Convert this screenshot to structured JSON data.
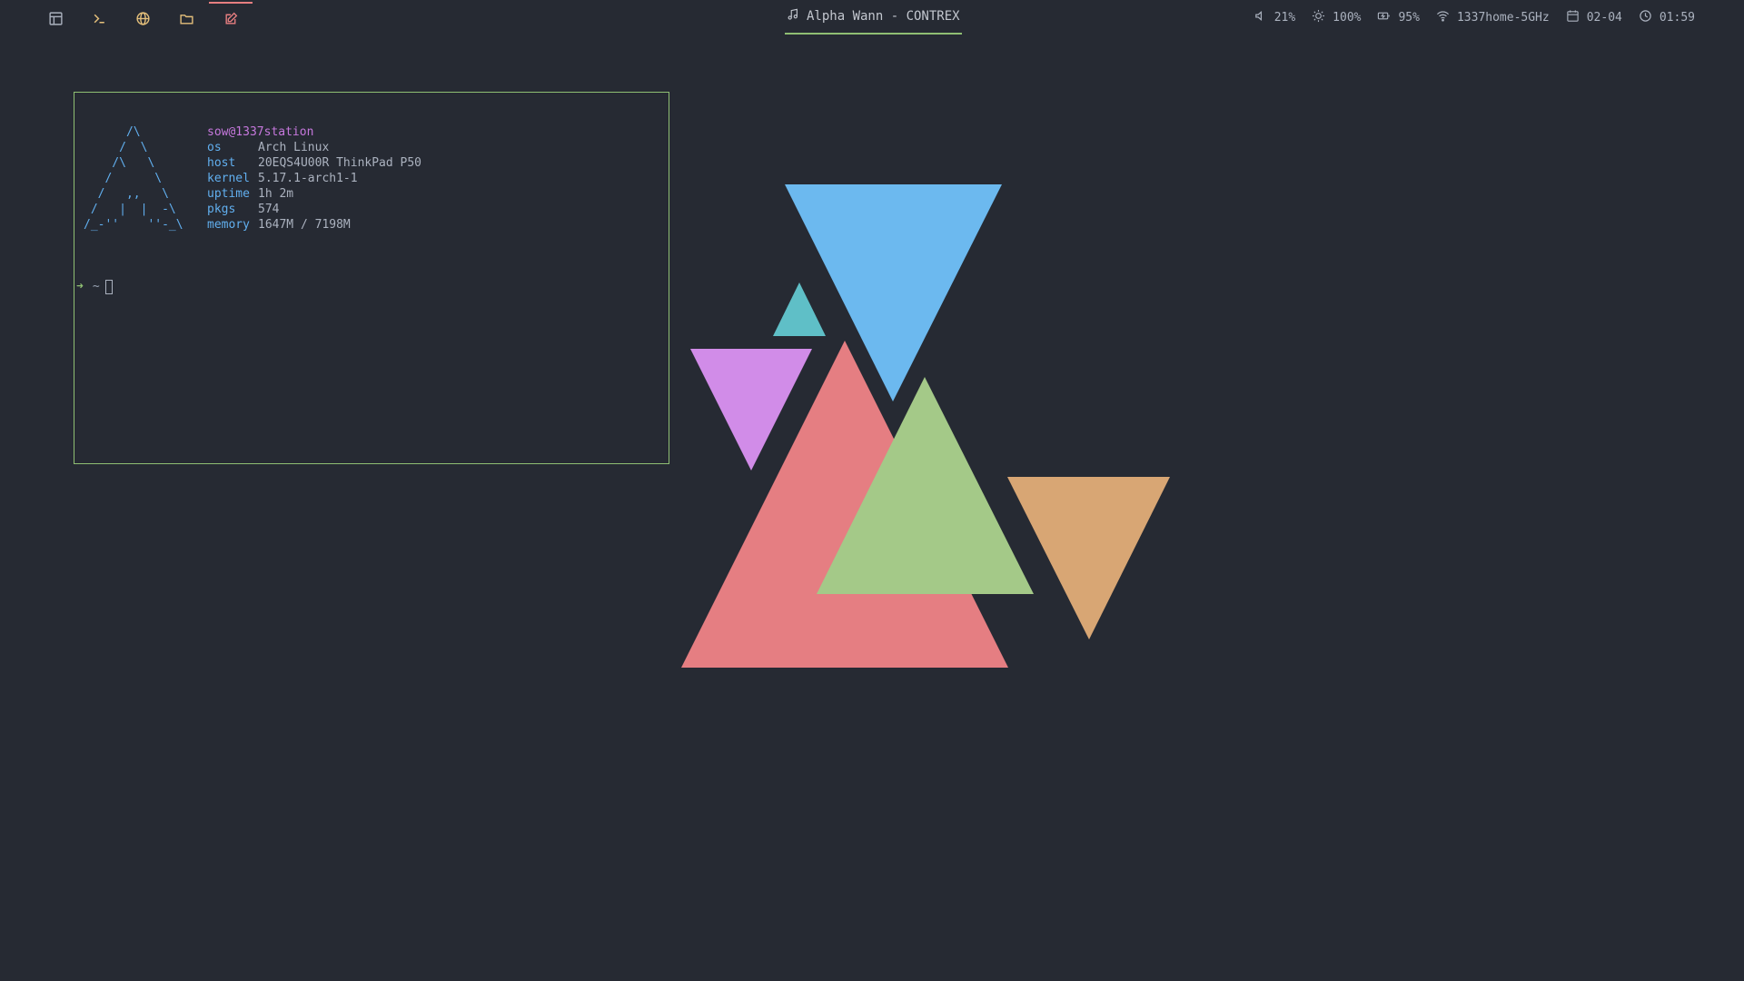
{
  "workspaces": [
    {
      "icon": "layout-icon",
      "color": "#abb2bf"
    },
    {
      "icon": "terminal-icon",
      "color": "#e5c07b"
    },
    {
      "icon": "globe-icon",
      "color": "#e5c07b"
    },
    {
      "icon": "folder-icon",
      "color": "#e5c07b"
    },
    {
      "icon": "edit-icon",
      "color": "#e67e80",
      "active": true
    }
  ],
  "media": {
    "icon": "music-note-icon",
    "title": "Alpha Wann - CONTREX"
  },
  "status": {
    "volume": "21%",
    "brightness": "100%",
    "battery": "95%",
    "wifi": "1337home-5GHz",
    "date": "02-04",
    "time": "01:59"
  },
  "terminal": {
    "logo": "      /\\\n     /  \\\n    /\\   \\\n   /      \\\n  /   ,,   \\\n /   |  |  -\\\n/_-''    ''-_\\",
    "user": "sow@1337station",
    "rows": [
      {
        "key": "os",
        "value": "Arch Linux"
      },
      {
        "key": "host",
        "value": "20EQS4U00R ThinkPad P50"
      },
      {
        "key": "kernel",
        "value": "5.17.1-arch1-1"
      },
      {
        "key": "uptime",
        "value": "1h 2m"
      },
      {
        "key": "pkgs",
        "value": "574"
      },
      {
        "key": "memory",
        "value": "1647M / 7198M"
      }
    ],
    "prompt_arrow": "➜",
    "prompt_dir": "~"
  },
  "colors": {
    "background": "#262a33",
    "accent_green": "#8fbf73",
    "accent_red": "#e67e80",
    "triangle_blue": "#6cb9ef",
    "triangle_cyan": "#5fbfc7",
    "triangle_purple": "#d18ce8",
    "triangle_red": "#e57e82",
    "triangle_green": "#a4c988",
    "triangle_orange": "#d8a674"
  }
}
